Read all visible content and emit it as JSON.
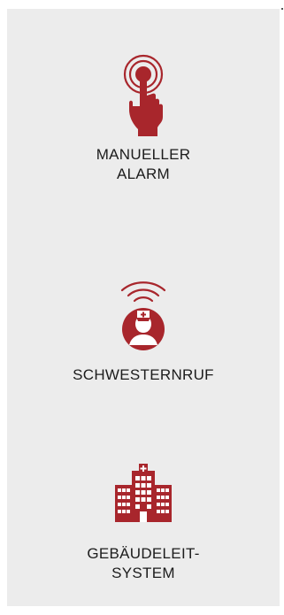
{
  "accent_color": "#a8262c",
  "items": [
    {
      "icon": "push-button-alarm-icon",
      "label_lines": [
        "MANUELLER",
        "ALARM"
      ]
    },
    {
      "icon": "nurse-call-icon",
      "label_lines": [
        "SCHWESTERNRUF"
      ]
    },
    {
      "icon": "hospital-building-icon",
      "label_lines": [
        "GEBÄUDELEIT-",
        "SYSTEM"
      ]
    }
  ]
}
